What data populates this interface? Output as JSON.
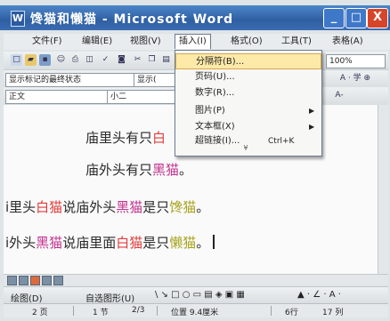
{
  "window": {
    "title": "馋猫和懒猫 - Microsoft Word",
    "app_icon": "W",
    "min_symbol": "_",
    "max_symbol": "□",
    "close_symbol": "X"
  },
  "menubar": {
    "items": [
      "文件(F)",
      "编辑(E)",
      "视图(V)",
      "插入(I)",
      "格式(O)",
      "工具(T)",
      "表格(A)"
    ]
  },
  "toolbar": {
    "zoom": "100%",
    "display_mode": "显示标记的最终状态",
    "display_mode2": "显示(",
    "style": "正文",
    "font_size": "小二",
    "ab_label": "A · 学 ⊕",
    "ab_label_left": "A-"
  },
  "insert_menu": {
    "items": [
      {
        "label": "分隔符(B)...",
        "shortcut": "",
        "submenu": false,
        "highlighted": true
      },
      {
        "label": "页码(U)...",
        "shortcut": "",
        "submenu": false,
        "highlighted": false
      },
      {
        "label": "数字(R)...",
        "shortcut": "",
        "submenu": false,
        "highlighted": false
      },
      {
        "label": "图片(P)",
        "shortcut": "",
        "submenu": true,
        "highlighted": false
      },
      {
        "label": "文本框(X)",
        "shortcut": "",
        "submenu": true,
        "highlighted": false
      },
      {
        "label": "超链接(I)...",
        "shortcut": "Ctrl+K",
        "submenu": false,
        "highlighted": false
      }
    ],
    "more_symbol": "¥"
  },
  "document": {
    "line1": {
      "a": "庙里头有只",
      "b": "白",
      "c": ""
    },
    "line2": {
      "a": "庙外头有只",
      "b": "黑猫",
      "c": "。"
    },
    "line3": {
      "a": "i里头",
      "b": "白猫",
      "c": "说庙外头",
      "d": "黑猫",
      "e": "是只",
      "f": "馋猫",
      "g": "。"
    },
    "line4": {
      "a": "i外头",
      "b": "黑猫",
      "c": "说庙里面",
      "d": "白猫",
      "e": "是只",
      "f": "懒猫",
      "g": "。"
    }
  },
  "drawbar": {
    "draw_label": "绘图(D)",
    "autoshapes_label": "自选图形(U)",
    "shapes": "\\ ↘ □ ○ ▭ ▤ ◈ ▣ ▦",
    "tools": "▲ · ∠ · A ·"
  },
  "statusbar": {
    "page": "2 页",
    "section": "1 节",
    "page_of": "2/3",
    "position": "位置 9.4厘米",
    "line": "6行",
    "col": "17 列"
  }
}
